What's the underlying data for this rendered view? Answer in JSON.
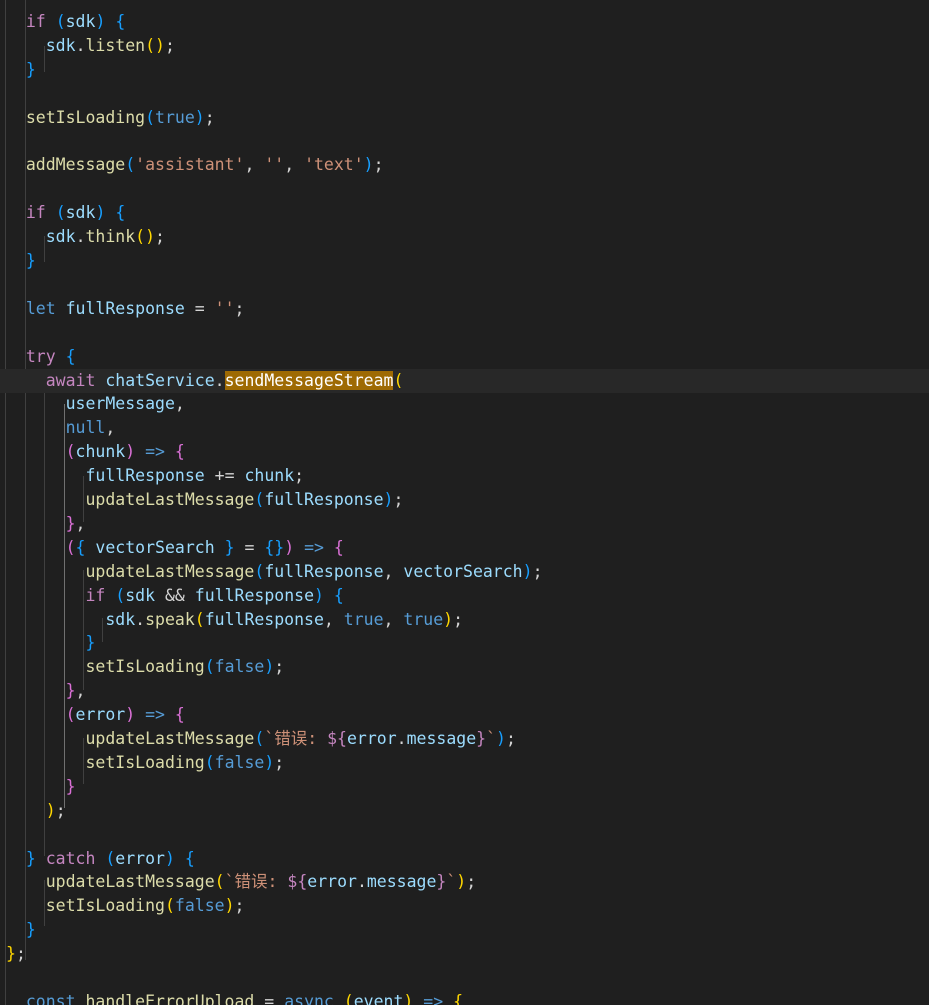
{
  "editor": {
    "lines": [
      {
        "tokens": [
          [
            "  ",
            "op"
          ],
          [
            "if",
            "ctl"
          ],
          [
            " ",
            "op"
          ],
          [
            "(",
            "b3"
          ],
          [
            "sdk",
            "var"
          ],
          [
            ")",
            "b3"
          ],
          [
            " ",
            "op"
          ],
          [
            "{",
            "b3"
          ]
        ]
      },
      {
        "tokens": [
          [
            "    ",
            "op"
          ],
          [
            "sdk",
            "var"
          ],
          [
            ".",
            "op"
          ],
          [
            "listen",
            "fn"
          ],
          [
            "()",
            "b1"
          ],
          [
            ";",
            "op"
          ]
        ]
      },
      {
        "tokens": [
          [
            "  ",
            "op"
          ],
          [
            "}",
            "b3"
          ]
        ]
      },
      {
        "tokens": []
      },
      {
        "tokens": [
          [
            "  ",
            "op"
          ],
          [
            "setIsLoading",
            "fn"
          ],
          [
            "(",
            "b3"
          ],
          [
            "true",
            "kw"
          ],
          [
            ")",
            "b3"
          ],
          [
            ";",
            "op"
          ]
        ]
      },
      {
        "tokens": []
      },
      {
        "tokens": [
          [
            "  ",
            "op"
          ],
          [
            "addMessage",
            "fn"
          ],
          [
            "(",
            "b3"
          ],
          [
            "'assistant'",
            "str"
          ],
          [
            ", ",
            "op"
          ],
          [
            "''",
            "str"
          ],
          [
            ", ",
            "op"
          ],
          [
            "'text'",
            "str"
          ],
          [
            ")",
            "b3"
          ],
          [
            ";",
            "op"
          ]
        ]
      },
      {
        "tokens": []
      },
      {
        "tokens": [
          [
            "  ",
            "op"
          ],
          [
            "if",
            "ctl"
          ],
          [
            " ",
            "op"
          ],
          [
            "(",
            "b3"
          ],
          [
            "sdk",
            "var"
          ],
          [
            ")",
            "b3"
          ],
          [
            " ",
            "op"
          ],
          [
            "{",
            "b3"
          ]
        ]
      },
      {
        "tokens": [
          [
            "    ",
            "op"
          ],
          [
            "sdk",
            "var"
          ],
          [
            ".",
            "op"
          ],
          [
            "think",
            "fn"
          ],
          [
            "()",
            "b1"
          ],
          [
            ";",
            "op"
          ]
        ]
      },
      {
        "tokens": [
          [
            "  ",
            "op"
          ],
          [
            "}",
            "b3"
          ]
        ]
      },
      {
        "tokens": []
      },
      {
        "tokens": [
          [
            "  ",
            "op"
          ],
          [
            "let",
            "kw"
          ],
          [
            " ",
            "op"
          ],
          [
            "fullResponse",
            "var"
          ],
          [
            " = ",
            "op"
          ],
          [
            "''",
            "str"
          ],
          [
            ";",
            "op"
          ]
        ]
      },
      {
        "tokens": []
      },
      {
        "tokens": [
          [
            "  ",
            "op"
          ],
          [
            "try",
            "ctl"
          ],
          [
            " ",
            "op"
          ],
          [
            "{",
            "b3"
          ]
        ]
      },
      {
        "current": true,
        "tokens": [
          [
            "    ",
            "op"
          ],
          [
            "await",
            "ctl"
          ],
          [
            " ",
            "op"
          ],
          [
            "chatService",
            "var"
          ],
          [
            ".",
            "op"
          ],
          [
            "sendMessageStream",
            "hl"
          ],
          [
            "(",
            "b1"
          ]
        ]
      },
      {
        "tokens": [
          [
            "      ",
            "op"
          ],
          [
            "userMessage",
            "var"
          ],
          [
            ",",
            "op"
          ]
        ]
      },
      {
        "tokens": [
          [
            "      ",
            "op"
          ],
          [
            "null",
            "kw"
          ],
          [
            ",",
            "op"
          ]
        ]
      },
      {
        "tokens": [
          [
            "      ",
            "op"
          ],
          [
            "(",
            "b2"
          ],
          [
            "chunk",
            "var"
          ],
          [
            ")",
            "b2"
          ],
          [
            " ",
            "op"
          ],
          [
            "=>",
            "kw"
          ],
          [
            " ",
            "op"
          ],
          [
            "{",
            "b2"
          ]
        ]
      },
      {
        "tokens": [
          [
            "        ",
            "op"
          ],
          [
            "fullResponse",
            "var"
          ],
          [
            " += ",
            "op"
          ],
          [
            "chunk",
            "var"
          ],
          [
            ";",
            "op"
          ]
        ]
      },
      {
        "tokens": [
          [
            "        ",
            "op"
          ],
          [
            "updateLastMessage",
            "fn"
          ],
          [
            "(",
            "b3"
          ],
          [
            "fullResponse",
            "var"
          ],
          [
            ")",
            "b3"
          ],
          [
            ";",
            "op"
          ]
        ]
      },
      {
        "tokens": [
          [
            "      ",
            "op"
          ],
          [
            "}",
            "b2"
          ],
          [
            ",",
            "op"
          ]
        ]
      },
      {
        "tokens": [
          [
            "      ",
            "op"
          ],
          [
            "(",
            "b2"
          ],
          [
            "{",
            "b3"
          ],
          [
            " ",
            "op"
          ],
          [
            "vectorSearch",
            "var"
          ],
          [
            " ",
            "op"
          ],
          [
            "}",
            "b3"
          ],
          [
            " = ",
            "op"
          ],
          [
            "{}",
            "b3"
          ],
          [
            ")",
            "b2"
          ],
          [
            " ",
            "op"
          ],
          [
            "=>",
            "kw"
          ],
          [
            " ",
            "op"
          ],
          [
            "{",
            "b2"
          ]
        ]
      },
      {
        "tokens": [
          [
            "        ",
            "op"
          ],
          [
            "updateLastMessage",
            "fn"
          ],
          [
            "(",
            "b3"
          ],
          [
            "fullResponse",
            "var"
          ],
          [
            ", ",
            "op"
          ],
          [
            "vectorSearch",
            "var"
          ],
          [
            ")",
            "b3"
          ],
          [
            ";",
            "op"
          ]
        ]
      },
      {
        "tokens": [
          [
            "        ",
            "op"
          ],
          [
            "if",
            "ctl"
          ],
          [
            " ",
            "op"
          ],
          [
            "(",
            "b3"
          ],
          [
            "sdk",
            "var"
          ],
          [
            " && ",
            "op"
          ],
          [
            "fullResponse",
            "var"
          ],
          [
            ")",
            "b3"
          ],
          [
            " ",
            "op"
          ],
          [
            "{",
            "b3"
          ]
        ]
      },
      {
        "tokens": [
          [
            "          ",
            "op"
          ],
          [
            "sdk",
            "var"
          ],
          [
            ".",
            "op"
          ],
          [
            "speak",
            "fn"
          ],
          [
            "(",
            "b1"
          ],
          [
            "fullResponse",
            "var"
          ],
          [
            ", ",
            "op"
          ],
          [
            "true",
            "kw"
          ],
          [
            ", ",
            "op"
          ],
          [
            "true",
            "kw"
          ],
          [
            ")",
            "b1"
          ],
          [
            ";",
            "op"
          ]
        ]
      },
      {
        "tokens": [
          [
            "        ",
            "op"
          ],
          [
            "}",
            "b3"
          ]
        ]
      },
      {
        "tokens": [
          [
            "        ",
            "op"
          ],
          [
            "setIsLoading",
            "fn"
          ],
          [
            "(",
            "b3"
          ],
          [
            "false",
            "kw"
          ],
          [
            ")",
            "b3"
          ],
          [
            ";",
            "op"
          ]
        ]
      },
      {
        "tokens": [
          [
            "      ",
            "op"
          ],
          [
            "}",
            "b2"
          ],
          [
            ",",
            "op"
          ]
        ]
      },
      {
        "tokens": [
          [
            "      ",
            "op"
          ],
          [
            "(",
            "b2"
          ],
          [
            "error",
            "var"
          ],
          [
            ")",
            "b2"
          ],
          [
            " ",
            "op"
          ],
          [
            "=>",
            "kw"
          ],
          [
            " ",
            "op"
          ],
          [
            "{",
            "b2"
          ]
        ]
      },
      {
        "tokens": [
          [
            "        ",
            "op"
          ],
          [
            "updateLastMessage",
            "fn"
          ],
          [
            "(",
            "b3"
          ],
          [
            "`错误: ",
            "str"
          ],
          [
            "${",
            "ctl"
          ],
          [
            "error",
            "var"
          ],
          [
            ".",
            "op"
          ],
          [
            "message",
            "var"
          ],
          [
            "}",
            "ctl"
          ],
          [
            "`",
            "str"
          ],
          [
            ")",
            "b3"
          ],
          [
            ";",
            "op"
          ]
        ]
      },
      {
        "tokens": [
          [
            "        ",
            "op"
          ],
          [
            "setIsLoading",
            "fn"
          ],
          [
            "(",
            "b3"
          ],
          [
            "false",
            "kw"
          ],
          [
            ")",
            "b3"
          ],
          [
            ";",
            "op"
          ]
        ]
      },
      {
        "tokens": [
          [
            "      ",
            "op"
          ],
          [
            "}",
            "b2"
          ]
        ]
      },
      {
        "tokens": [
          [
            "    ",
            "op"
          ],
          [
            ")",
            "b1"
          ],
          [
            ";",
            "op"
          ]
        ]
      },
      {
        "tokens": []
      },
      {
        "tokens": [
          [
            "  ",
            "op"
          ],
          [
            "}",
            "b3"
          ],
          [
            " ",
            "op"
          ],
          [
            "catch",
            "ctl"
          ],
          [
            " ",
            "op"
          ],
          [
            "(",
            "b3"
          ],
          [
            "error",
            "var"
          ],
          [
            ")",
            "b3"
          ],
          [
            " ",
            "op"
          ],
          [
            "{",
            "b3"
          ]
        ]
      },
      {
        "tokens": [
          [
            "    ",
            "op"
          ],
          [
            "updateLastMessage",
            "fn"
          ],
          [
            "(",
            "b1"
          ],
          [
            "`错误: ",
            "str"
          ],
          [
            "${",
            "ctl"
          ],
          [
            "error",
            "var"
          ],
          [
            ".",
            "op"
          ],
          [
            "message",
            "var"
          ],
          [
            "}",
            "ctl"
          ],
          [
            "`",
            "str"
          ],
          [
            ")",
            "b1"
          ],
          [
            ";",
            "op"
          ]
        ]
      },
      {
        "tokens": [
          [
            "    ",
            "op"
          ],
          [
            "setIsLoading",
            "fn"
          ],
          [
            "(",
            "b1"
          ],
          [
            "false",
            "kw"
          ],
          [
            ")",
            "b1"
          ],
          [
            ";",
            "op"
          ]
        ]
      },
      {
        "tokens": [
          [
            "  ",
            "op"
          ],
          [
            "}",
            "b3"
          ]
        ]
      },
      {
        "tokens": [
          [
            "}",
            "b1"
          ],
          [
            ";",
            "op"
          ]
        ]
      },
      {
        "tokens": []
      },
      {
        "tokens": [
          [
            "  ",
            "op"
          ],
          [
            "const",
            "kw"
          ],
          [
            " ",
            "op"
          ],
          [
            "handleErrorUpload",
            "fn"
          ],
          [
            " = ",
            "op"
          ],
          [
            "async",
            "kw"
          ],
          [
            " ",
            "op"
          ],
          [
            "(",
            "b1"
          ],
          [
            "event",
            "var"
          ],
          [
            ")",
            "b1"
          ],
          [
            " ",
            "op"
          ],
          [
            "=>",
            "kw"
          ],
          [
            " ",
            "op"
          ],
          [
            "{",
            "b1"
          ]
        ]
      }
    ]
  }
}
